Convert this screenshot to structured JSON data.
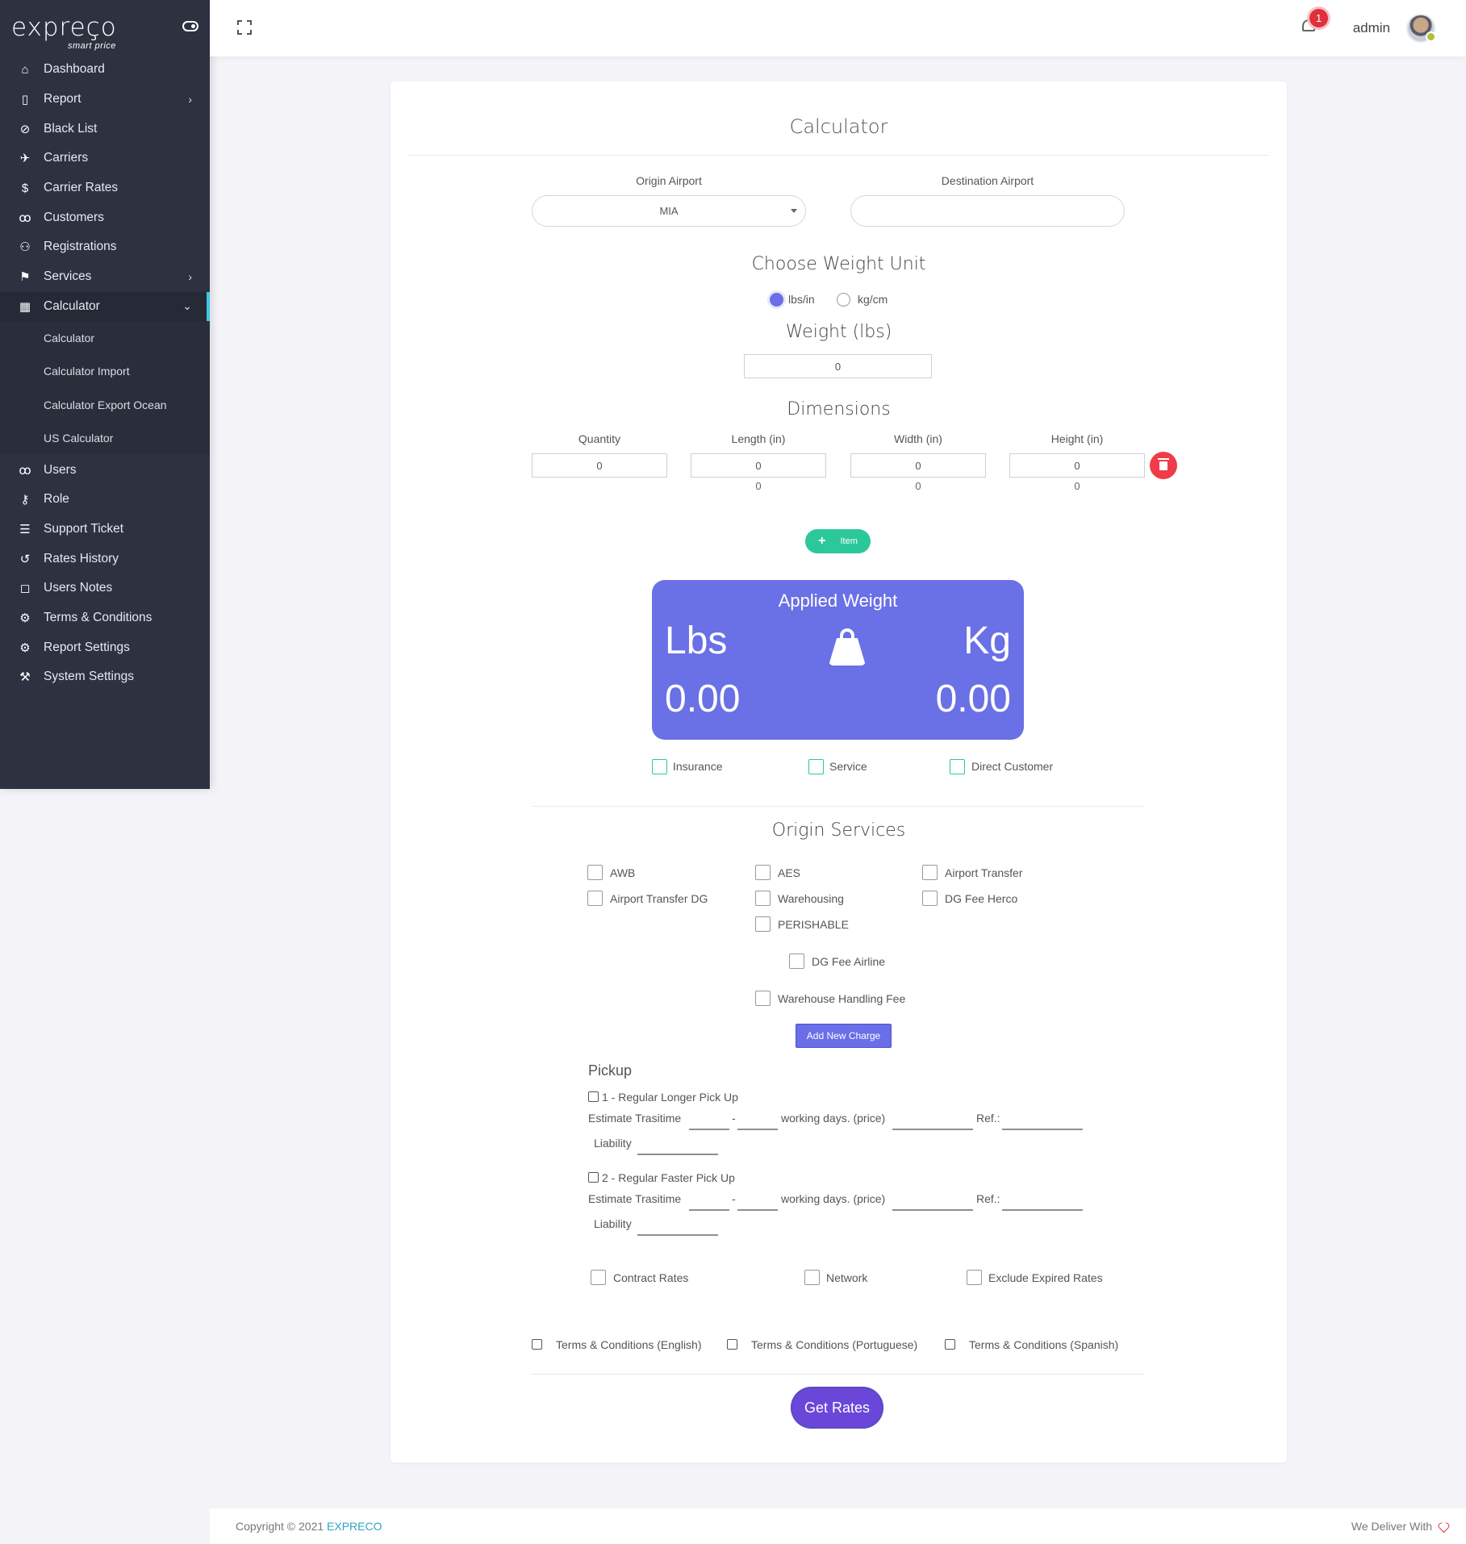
{
  "brand": {
    "name": "expreço",
    "tagline": "smart price"
  },
  "sidebar": {
    "items": [
      {
        "label": "Dashboard",
        "icon": "home-icon"
      },
      {
        "label": "Report",
        "icon": "document-icon",
        "has_children": true
      },
      {
        "label": "Black List",
        "icon": "users-block-icon"
      },
      {
        "label": "Carriers",
        "icon": "airplane-icon"
      },
      {
        "label": "Carrier Rates",
        "icon": "dollar-icon"
      },
      {
        "label": "Customers",
        "icon": "customers-icon"
      },
      {
        "label": "Registrations",
        "icon": "user-add-icon"
      },
      {
        "label": "Services",
        "icon": "flag-icon",
        "has_children": true
      },
      {
        "label": "Calculator",
        "icon": "calculator-icon",
        "expanded": true
      }
    ],
    "calculator_sub": [
      "Calculator",
      "Calculator Import",
      "Calculator Export Ocean",
      "US Calculator"
    ],
    "items_after": [
      {
        "label": "Users",
        "icon": "users-icon"
      },
      {
        "label": "Role",
        "icon": "key-icon"
      },
      {
        "label": "Support Ticket",
        "icon": "ticket-icon"
      },
      {
        "label": "Rates History",
        "icon": "history-icon"
      },
      {
        "label": "Users Notes",
        "icon": "note-icon"
      },
      {
        "label": "Terms & Conditions",
        "icon": "gears-icon"
      },
      {
        "label": "Report Settings",
        "icon": "gear-icon"
      },
      {
        "label": "System Settings",
        "icon": "wrench-icon"
      }
    ]
  },
  "topbar": {
    "notification_count": "1",
    "user_name": "admin"
  },
  "calculator": {
    "title": "Calculator",
    "origin_label": "Origin Airport",
    "origin_value": "MIA",
    "destination_label": "Destination Airport",
    "destination_value": "",
    "weight_unit_title": "Choose Weight Unit",
    "unit_options": [
      "lbs/in",
      "kg/cm"
    ],
    "selected_unit": "lbs/in",
    "weight_title": "Weight (lbs)",
    "weight_value": "0",
    "dimensions_title": "Dimensions",
    "dim_labels": [
      "Quantity",
      "Length (in)",
      "Width (in)",
      "Height (in)"
    ],
    "dim_values": [
      "0",
      "0",
      "0",
      "0"
    ],
    "dim_sub_values": [
      "0",
      "0",
      "0"
    ],
    "add_item_label": "Item",
    "applied": {
      "title": "Applied Weight",
      "lbs_label": "Lbs",
      "kg_label": "Kg",
      "lbs_value": "0.00",
      "kg_value": "0.00"
    },
    "options": [
      "Insurance",
      "Service",
      "Direct Customer"
    ],
    "origin_services_title": "Origin Services",
    "origin_services": [
      "AWB",
      "AES",
      "Airport Transfer",
      "Airport Transfer DG",
      "Warehousing",
      "DG Fee Herco",
      "PERISHABLE",
      "DG Fee Airline",
      "Warehouse Handling Fee"
    ],
    "add_charge_label": "Add New Charge",
    "pickup": {
      "title": "Pickup",
      "options": [
        {
          "label": "1 - Regular Longer Pick Up"
        },
        {
          "label": "2 - Regular Faster Pick Up"
        }
      ],
      "estimate_label": "Estimate Trasitime",
      "dash": "-",
      "working_days_label": "working days. (price)",
      "ref_label": "Ref.:",
      "liability_label": "Liability"
    },
    "rate_filters": [
      "Contract Rates",
      "Network",
      "Exclude Expired Rates"
    ],
    "terms": [
      "Terms & Conditions (English)",
      "Terms & Conditions (Portuguese)",
      "Terms & Conditions (Spanish)"
    ],
    "get_rates_label": "Get Rates"
  },
  "footer": {
    "copyright": "Copyright © 2021",
    "brand": "EXPRECO",
    "right": "We Deliver With"
  },
  "colors": {
    "sidebar": "#2e3240",
    "accent": "#6a6ee8",
    "teal": "#2cc89b",
    "danger": "#ef3c48"
  }
}
